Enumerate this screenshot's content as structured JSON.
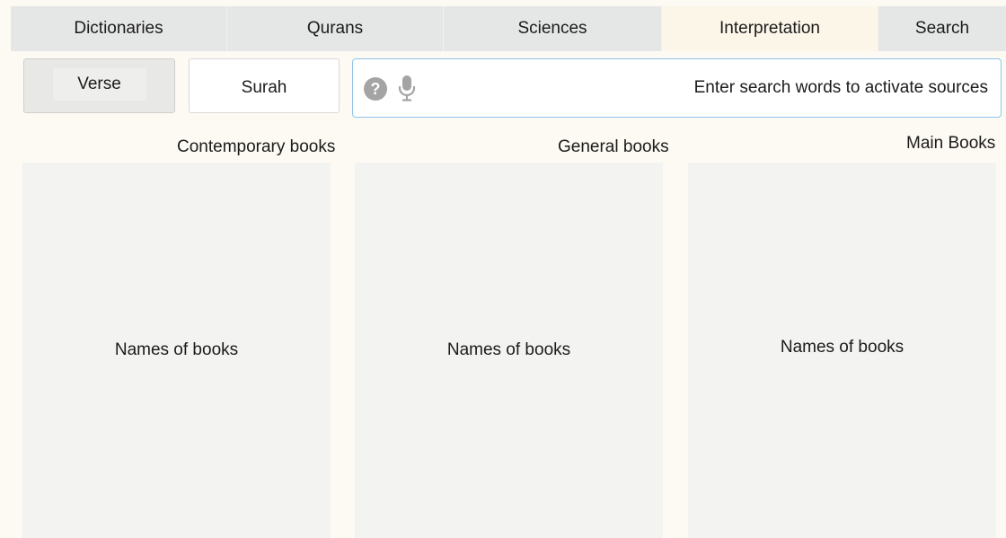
{
  "tabs": [
    {
      "label": "Dictionaries",
      "active": false
    },
    {
      "label": "Qurans",
      "active": false
    },
    {
      "label": "Sciences",
      "active": false
    },
    {
      "label": "Interpretation",
      "active": true
    },
    {
      "label": "Search",
      "active": false
    }
  ],
  "scope_buttons": {
    "verse": "Verse",
    "surah": "Surah"
  },
  "search": {
    "placeholder": "Enter search words to activate sources",
    "value": "",
    "help_icon": "question-circle-icon",
    "mic_icon": "microphone-icon"
  },
  "columns": [
    {
      "title": "Contemporary books",
      "placeholder": "Names of books"
    },
    {
      "title": "General books",
      "placeholder": "Names of books"
    },
    {
      "title": "Main Books",
      "placeholder": "Names of books"
    }
  ],
  "colors": {
    "background": "#fdfaf3",
    "tab_bar": "#e5e6e6",
    "tab_active": "#fcf6e9",
    "panel": "#f3f3f2",
    "search_border": "#8fc2ea",
    "icon": "#a4a4a4"
  }
}
